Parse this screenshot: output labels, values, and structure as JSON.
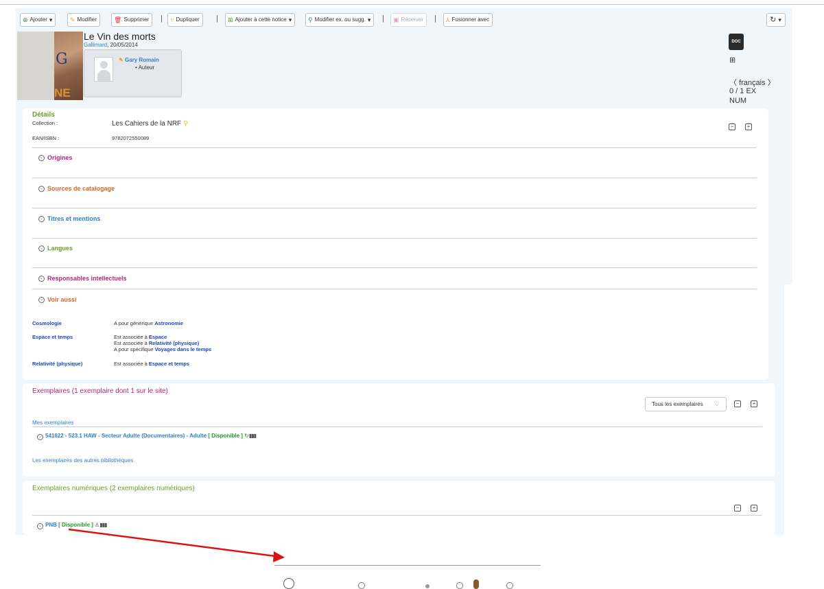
{
  "toolbar": {
    "add": "Ajouter",
    "edit": "Modifier",
    "delete": "Supprimer",
    "duplicate": "Dupliquer",
    "add_to_record": "Ajouter à cette notice",
    "edit_ex": "Modifier ex. ou sugg.",
    "reserve": "Réserver",
    "merge": "Fusionner avec"
  },
  "record": {
    "title": "Le Vin des morts",
    "publisher": "Gallimard",
    "date": ", 20/05/2014",
    "author_name": "Gary Romain",
    "author_role": "Auteur",
    "doc_badge": "DOC",
    "language": "français",
    "count": "0 / 1 EX",
    "num": "NUM"
  },
  "details": {
    "heading": "Détails",
    "collection_label": "Collection :",
    "collection_value": "Les Cahiers de la NRF",
    "isbn_label": "EAN/ISBN :",
    "isbn_value": "9782072550089"
  },
  "sections": {
    "origins": "Origines",
    "sources": "Sources de catalogage",
    "titles": "Titres et mentions",
    "languages": "Langues",
    "responsables": "Responsables intellectuels",
    "see_also": "Voir aussi"
  },
  "see_also": {
    "r1_term": "Cosmologie",
    "r1_l1_text": "A pour générique ",
    "r1_l1_link": "Astronomie",
    "r2_term": "Espace et temps",
    "r2_l1_text": "Est associée à ",
    "r2_l1_link": "Espace",
    "r2_l2_text": "Est associée à ",
    "r2_l2_link": "Relativité (physique)",
    "r2_l3_text": "A pour spécifique ",
    "r2_l3_link": "Voyages dans le temps",
    "r3_term": "Relativité (physique)",
    "r3_l1_text": "Est associée à ",
    "r3_l1_link": "Espace et temps"
  },
  "copies": {
    "heading": "Exemplaires (1 exemplaire dont 1 sur le site)",
    "filter": "Tous les exemplaires",
    "mine": "Mes exemplaires",
    "item_text": "541622 - 523.1 HAW - Secteur Adulte (Documentaires) - Adulte",
    "item_status": "[ Disponible ]",
    "others": "Les exemplaires des autres bibliothèques"
  },
  "digital": {
    "heading": "Exemplaires numériques (2 exemplaires numériques)",
    "item_label": "PNB",
    "item_status": "[ Disponible ]"
  },
  "colors": {
    "accent_blue": "#2f7fd0",
    "details_green": "#6aa02a",
    "section_magenta": "#b0287e",
    "section_orange": "#e0662a",
    "available_green": "#1f9a2c",
    "arrow_red": "#e01010"
  }
}
